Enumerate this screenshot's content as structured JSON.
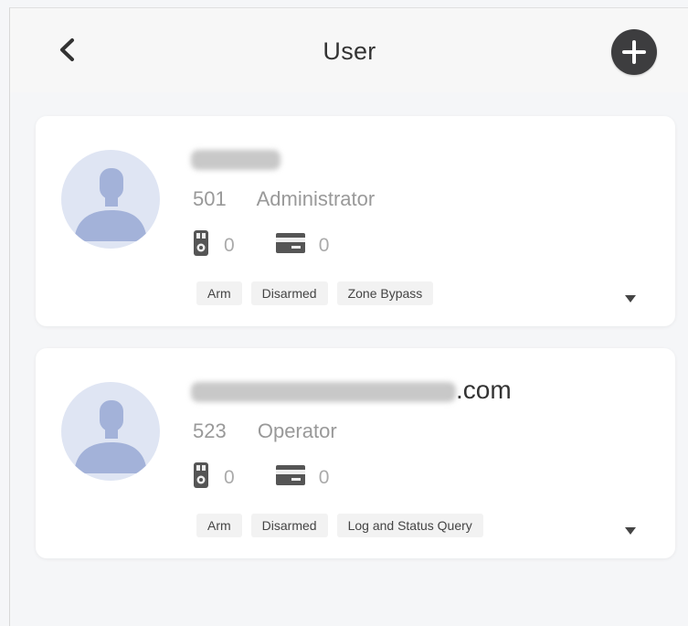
{
  "header": {
    "title": "User"
  },
  "users": [
    {
      "user_id": "501",
      "role": "Administrator",
      "keyfob_count": "0",
      "card_count": "0",
      "permissions": [
        "Arm",
        "Disarmed",
        "Zone Bypass"
      ]
    },
    {
      "name_suffix": ".com",
      "user_id": "523",
      "role": "Operator",
      "keyfob_count": "0",
      "card_count": "0",
      "permissions": [
        "Arm",
        "Disarmed",
        "Log and Status Query"
      ]
    }
  ],
  "icons": {
    "back": "chevron-left-icon",
    "add": "plus-circle-icon",
    "avatar": "person-silhouette-icon",
    "keyfob": "keyfob-icon",
    "card": "card-icon",
    "expand": "caret-down-icon"
  },
  "colors": {
    "page_bg": "#f5f6f8",
    "card_bg": "#ffffff",
    "avatar_bg": "#dfe5f3",
    "avatar_figure": "#a3b2d9",
    "add_button": "#3d3d3f",
    "tag_bg": "#f2f2f2",
    "muted_text": "#999999"
  }
}
